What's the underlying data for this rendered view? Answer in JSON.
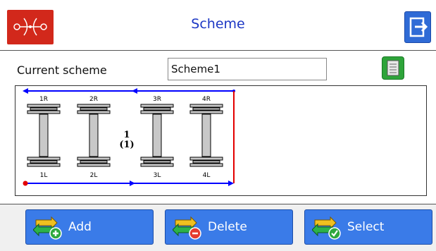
{
  "header": {
    "title": "Scheme",
    "logo_icon": "red-symbol-logo",
    "exit_icon": "exit-door-icon",
    "title_color": "#1c37c4"
  },
  "form": {
    "current_scheme_label": "Current scheme",
    "current_scheme_value": "Scheme1",
    "notes_icon": "document-icon"
  },
  "diagram": {
    "top_labels": [
      "1R",
      "2R",
      "3R",
      "4R"
    ],
    "bottom_labels": [
      "1L",
      "2L",
      "3L",
      "4L"
    ],
    "center_number": "1",
    "center_sub": "(1)",
    "arrow_color": "#0000ff",
    "end_color": "#e30000"
  },
  "footer": {
    "buttons": [
      {
        "label": "Add",
        "icon": "add-icon"
      },
      {
        "label": "Delete",
        "icon": "delete-icon"
      },
      {
        "label": "Select",
        "icon": "select-icon"
      }
    ]
  }
}
